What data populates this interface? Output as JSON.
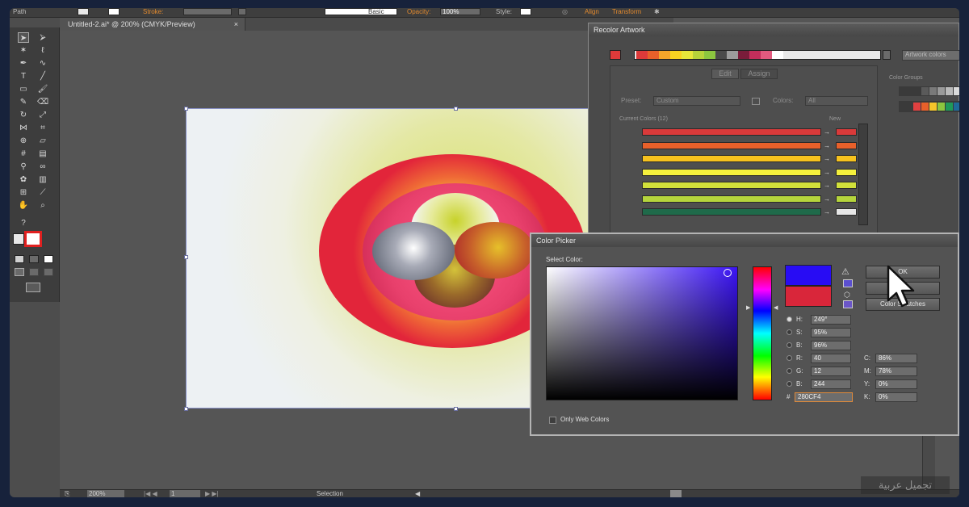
{
  "control_bar": {
    "item_path": "Path",
    "stroke_label": "Stroke:",
    "stroke_style": "Basic",
    "opacity_label": "Opacity:",
    "opacity_value": "100%",
    "style_label": "Style:",
    "align_label": "Align",
    "transform_label": "Transform"
  },
  "document": {
    "tab_title": "Untitled-2.ai* @ 200% (CMYK/Preview)",
    "tab_close": "×"
  },
  "toolbar": {
    "tools": [
      "selection-tool",
      "direct-selection-tool",
      "magic-wand-tool",
      "lasso-tool",
      "pen-tool",
      "curvature-tool",
      "type-tool",
      "line-tool",
      "rectangle-tool",
      "paintbrush-tool",
      "pencil-tool",
      "eraser-tool",
      "rotate-tool",
      "scale-tool",
      "width-tool",
      "free-transform-tool",
      "shape-builder-tool",
      "perspective-tool",
      "mesh-tool",
      "gradient-tool",
      "eyedropper-tool",
      "blend-tool",
      "symbol-sprayer-tool",
      "column-graph-tool",
      "artboard-tool",
      "slice-tool",
      "hand-tool",
      "zoom-tool"
    ],
    "help_glyph": "?"
  },
  "status_bar": {
    "zoom": "200%",
    "artboard_number": "1",
    "tool_name": "Selection"
  },
  "recolor": {
    "title": "Recolor Artwork",
    "preset_name": "Artwork colors",
    "tab_edit": "Edit",
    "tab_assign": "Assign",
    "preset_label": "Preset:",
    "preset_value": "Custom",
    "colors_label": "Colors:",
    "colors_value": "All",
    "current_colors_label": "Current Colors (12)",
    "new_label": "New",
    "color_groups_label": "Color Groups",
    "swatch_colors": [
      "#dd3a3a",
      "#e8602a",
      "#f5a52a",
      "#f7d321",
      "#e7e73a",
      "#b7d33a",
      "#8cc63f",
      "#4a4a4a",
      "#9c9c9c",
      "#7a1c3a",
      "#c42e5b",
      "#e25a7e",
      "#ffffff"
    ],
    "rows": [
      {
        "current": "#d93a3a",
        "new": "#d93a3a"
      },
      {
        "current": "#e8602a",
        "new": "#e8602a"
      },
      {
        "current": "#f7c21e",
        "new": "#f7c21e"
      },
      {
        "current": "#f5f03c",
        "new": "#f5f03c"
      },
      {
        "current": "#d1e03a",
        "new": "#d1e03a"
      },
      {
        "current": "#b5d43c",
        "new": "#b5d43c"
      },
      {
        "current": "#1f6a4a",
        "new": "#e6e6e6"
      }
    ],
    "group1": [
      "#3a3a3a",
      "#5a5a5a",
      "#7a7a7a",
      "#9a9a9a",
      "#bababa",
      "#dadada"
    ],
    "group2": [
      "#e04040",
      "#e8602a",
      "#f5c52a",
      "#8cc63f",
      "#1f9a5a",
      "#1f6a9a"
    ]
  },
  "color_picker": {
    "title": "Color Picker",
    "select_label": "Select Color:",
    "new_color": "#280CF4",
    "old_color": "#d9263a",
    "hue_label": "H:",
    "hue_value": "249°",
    "sat_label": "S:",
    "sat_value": "95%",
    "bright_label": "B:",
    "bright_value": "96%",
    "r_label": "R:",
    "r_value": "40",
    "g_label": "G:",
    "g_value": "12",
    "b_label": "B:",
    "b_value": "244",
    "hex_label": "#",
    "hex_value": "280CF4",
    "c_label": "C:",
    "c_value": "86%",
    "m_label": "M:",
    "m_value": "78%",
    "y_label": "Y:",
    "y_value": "0%",
    "k_label": "K:",
    "k_value": "0%",
    "ok_label": "OK",
    "cancel_label": "",
    "swatches_label": "Color Swatches",
    "web_only_label": "Only Web Colors"
  },
  "watermark": "تجميل عربية"
}
